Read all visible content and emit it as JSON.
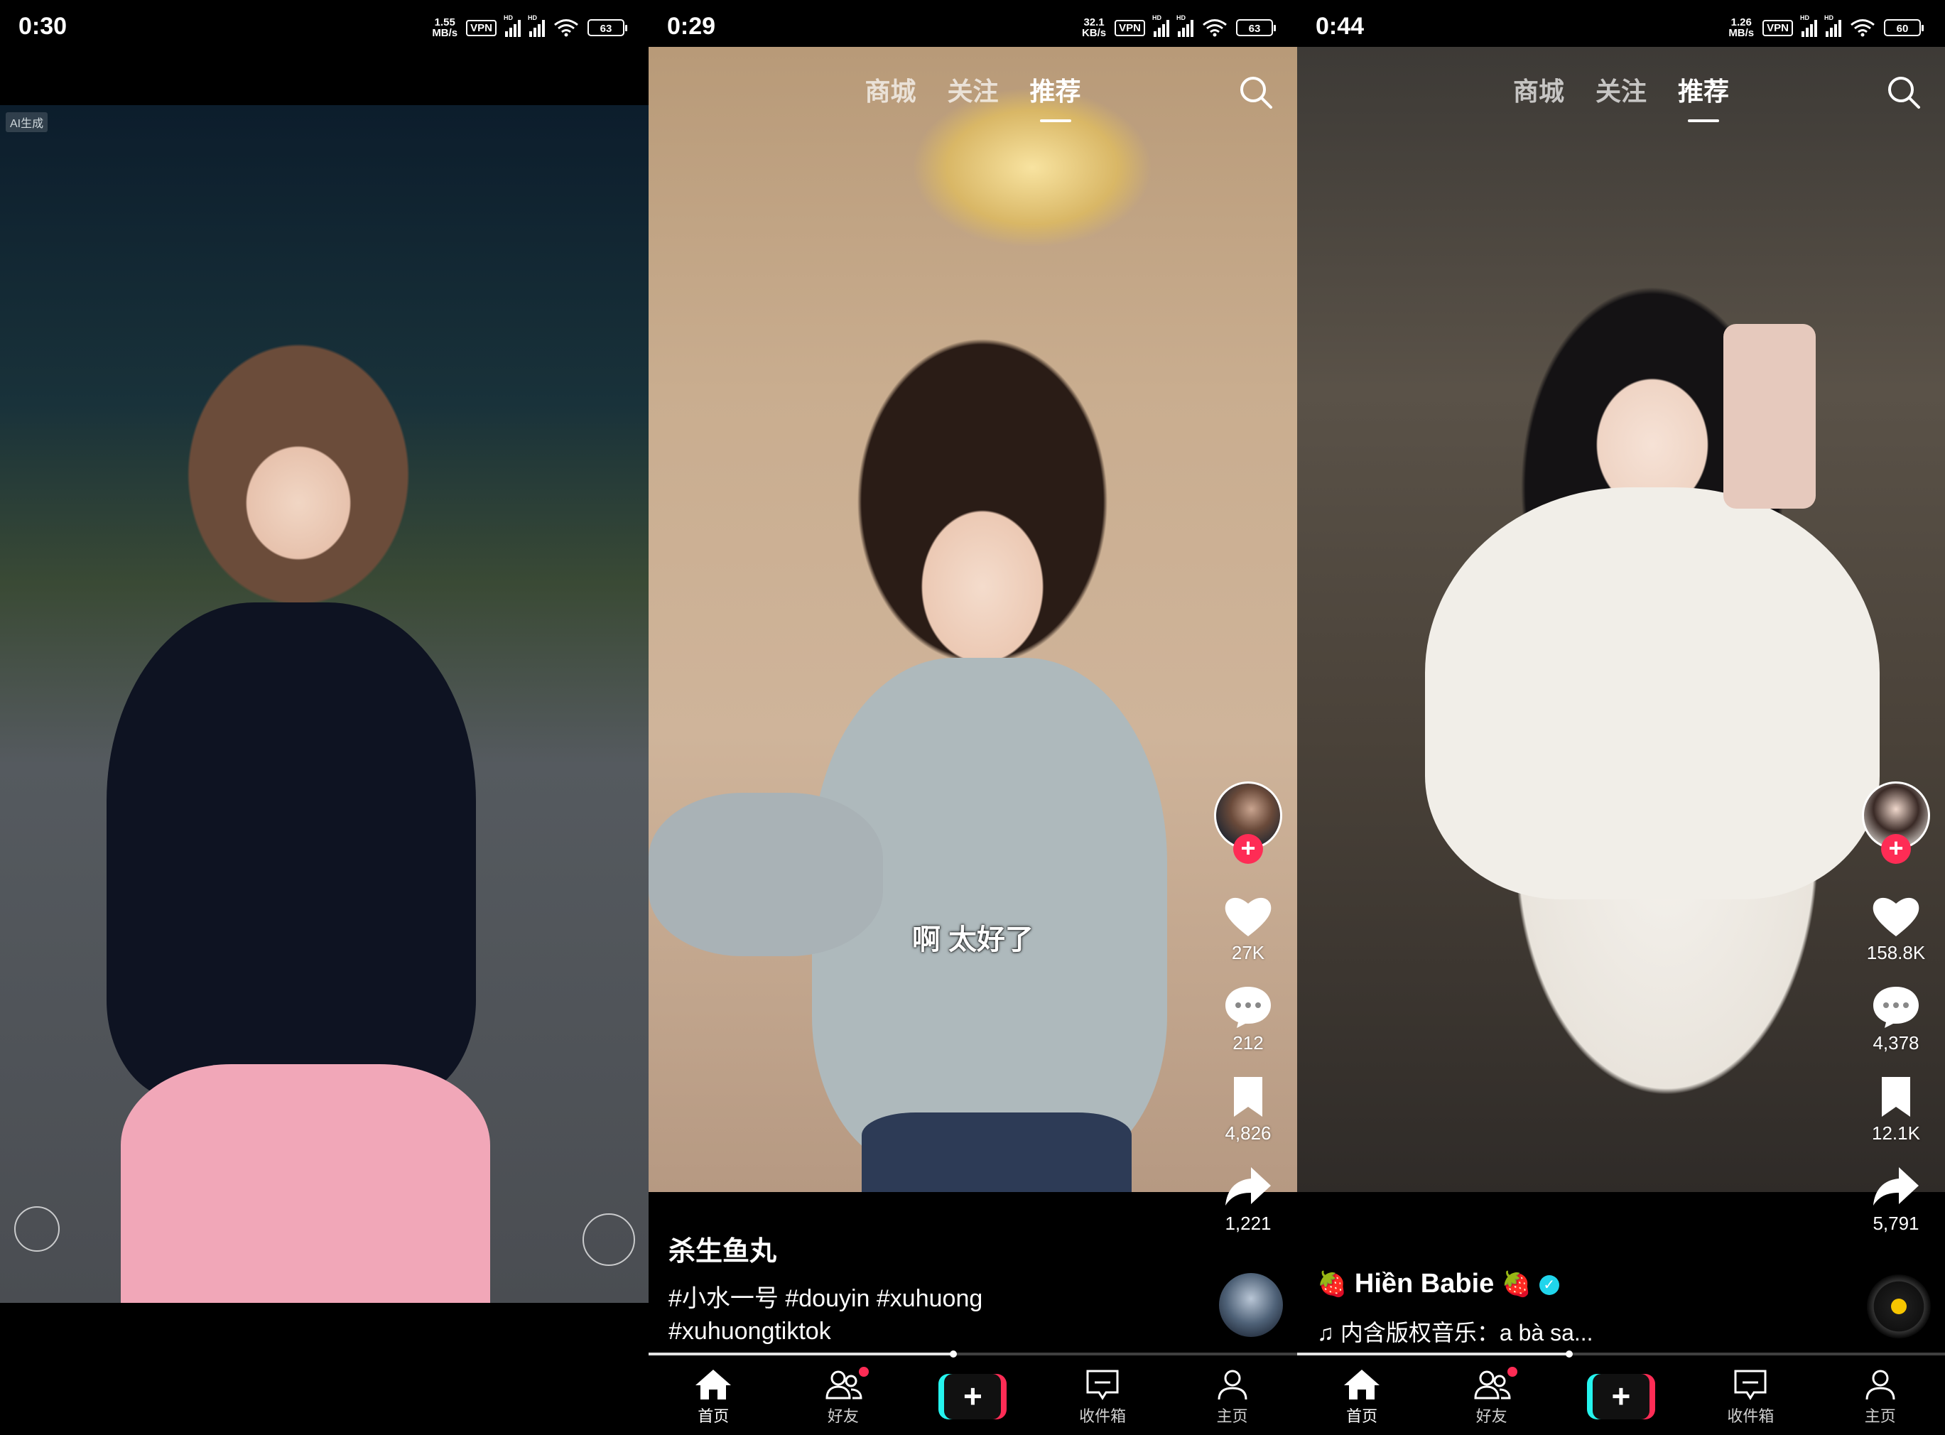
{
  "panels": [
    {
      "status": {
        "time": "0:30",
        "net_speed_value": "1.55",
        "net_speed_unit": "MB/s",
        "vpn": "VPN",
        "sig1_label": "HD",
        "sig2_label": "HD",
        "battery": "63"
      },
      "ai_tag": "AI生成"
    },
    {
      "status": {
        "time": "0:29",
        "net_speed_value": "32.1",
        "net_speed_unit": "KB/s",
        "vpn": "VPN",
        "sig1_label": "HD",
        "sig2_label": "HD",
        "battery": "63"
      },
      "tabs": [
        "商城",
        "关注",
        "推荐"
      ],
      "active_tab": "推荐",
      "caption": "啊 太好了",
      "likes": "27K",
      "comments": "212",
      "favorites": "4,826",
      "shares": "1,221",
      "author": "杀生鱼丸",
      "description": "#小水一号 #douyin #xuhuong #xuhuongtiktok",
      "progress": 0.47
    },
    {
      "status": {
        "time": "0:44",
        "net_speed_value": "1.26",
        "net_speed_unit": "MB/s",
        "vpn": "VPN",
        "sig1_label": "HD",
        "sig2_label": "HD",
        "battery": "60"
      },
      "tabs": [
        "商城",
        "关注",
        "推荐"
      ],
      "active_tab": "推荐",
      "likes": "158.8K",
      "comments": "4,378",
      "favorites": "12.1K",
      "shares": "5,791",
      "author": "Hiền Babie",
      "author_emoji": "🍓",
      "music": "♫ 内含版权音乐：a bà sa...",
      "progress": 0.42
    }
  ],
  "nav": {
    "home": "首页",
    "friends": "好友",
    "create": "+",
    "inbox": "收件箱",
    "profile": "主页"
  },
  "colors": {
    "accent_red": "#fe2c55",
    "accent_cyan": "#25f4ee",
    "verified": "#20d5ec",
    "disc_dot": "#f7c600"
  }
}
